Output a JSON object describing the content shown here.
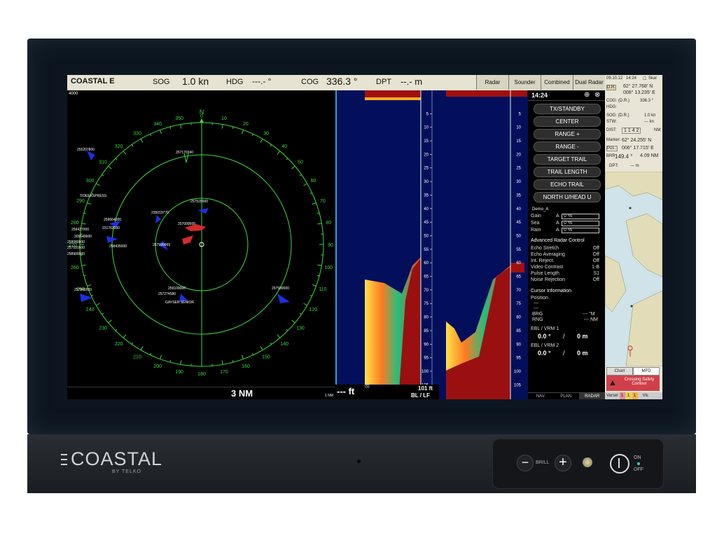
{
  "brand": {
    "name": "COASTAL",
    "sub": "BY TELKO"
  },
  "controls": {
    "brill": "BRILL",
    "on": "ON",
    "off": "OFF"
  },
  "topbar": {
    "product": "COASTAL E",
    "sog_label": "SOG",
    "sog_value": "1.0 kn",
    "hdg_label": "HDG",
    "hdg_value": "---.- °",
    "cog_label": "COG",
    "cog_value": "336.3 °",
    "dpt_label": "DPT",
    "dpt_value": "--.- m",
    "tabs": [
      "Radar",
      "Sounder",
      "Combined",
      "Dual Radar"
    ]
  },
  "radar": {
    "range": "3 NM",
    "corner_range": "4000",
    "small_range": "1 NM",
    "ring_labels": [
      "0",
      "10",
      "20",
      "30",
      "40",
      "50",
      "60",
      "70",
      "80",
      "90",
      "100",
      "110",
      "120",
      "130",
      "140",
      "150",
      "160",
      "170",
      "180",
      "190",
      "200",
      "210",
      "220",
      "230",
      "240",
      "250",
      "260",
      "270",
      "280",
      "290",
      "300",
      "310",
      "320",
      "330",
      "340",
      "350"
    ],
    "targets": [
      "257170340",
      "255207800",
      "TIDEEKSPRESS",
      "257529000",
      "235019770",
      "257009500",
      "259664000",
      "231763000",
      "259437000",
      "305649000",
      "258080000",
      "257591600",
      "258900000",
      "257999969",
      "258435000",
      "257846000",
      "259109000",
      "257274580",
      "GAYSER SENIOR",
      "257599000"
    ]
  },
  "sounder": {
    "depth_ticks": [
      "5",
      "10",
      "15",
      "20",
      "25",
      "30",
      "35",
      "40",
      "45",
      "50",
      "55",
      "60",
      "65",
      "70",
      "75",
      "80",
      "85",
      "90",
      "95",
      "100",
      "105"
    ],
    "depth_readout": "--- ft",
    "depth_sup": "(S)",
    "range_label": "101 ft",
    "mode": "BL / LF"
  },
  "menu": {
    "time": "14:24",
    "buttons": [
      "TX/STANDBY",
      "CENTER",
      "RANGE +",
      "RANGE -",
      "TARGET TRAIL",
      "TRAIL LENGTH",
      "ECHO TRAIL",
      "NORTH U/HEAD U"
    ],
    "demo": "Demo_A",
    "gain_rows": [
      {
        "label": "Gain",
        "mode": "A",
        "value": "0 %"
      },
      {
        "label": "Sea",
        "mode": "A",
        "value": "0 %"
      },
      {
        "label": "Rain",
        "mode": "A",
        "value": "0 %"
      }
    ],
    "adv_title": "Advanced Radar Control",
    "adv_rows": [
      {
        "label": "Echo Stretch",
        "value": "Off"
      },
      {
        "label": "Echo Averaging",
        "value": "Off"
      },
      {
        "label": "Int. Reject.",
        "value": "Off"
      },
      {
        "label": "Video Contrast",
        "value": "1-B"
      },
      {
        "label": "Pulse Length",
        "value": "S1"
      },
      {
        "label": "Noise Rejection",
        "value": "Off"
      }
    ],
    "cursor_title": "Cursor Information",
    "position_label": "Position",
    "position_value1": "---",
    "position_value2": "---",
    "brg_label": "BRG",
    "brg_value": "--- °M",
    "rng_label": "RNG",
    "rng_value": "--- NM",
    "ebl1_title": "EBL / VRM 1",
    "ebl1_deg": "0.0 °",
    "ebl1_slash": "/",
    "ebl1_m": "0 m",
    "ebl2_title": "EBL / VRM 2",
    "ebl2_deg": "0.0 °",
    "ebl2_slash": "/",
    "ebl2_m": "0 m",
    "bottom_tabs": [
      "NAV.",
      "PLAN.",
      "RADAR"
    ]
  },
  "rightpanel": {
    "date": "09.10.12",
    "time": "14:24",
    "skal": "Skal",
    "dr": "D.R.",
    "lat": "62° 27.768' N",
    "lon": "006° 13.235' E",
    "cog_label": "COG: (D.R.)",
    "cog_value": "336.3 °",
    "hdg_label": "HDG:",
    "sog_label": "SOG: (D.R.)",
    "sog_value": "1.0 kn",
    "stw_label": "STW:",
    "stw_value": "--- kn",
    "dist_label": "DIST:",
    "dist_value": "1 1 4 2",
    "dist_unit": "NM",
    "marker_label": "Marker:",
    "marker_lat": "62° 24.255' N",
    "pos_label": "Pos.:",
    "marker_lon": "006° 17.715' E",
    "brr_label": "BRR",
    "brr_value": "149.4 °",
    "brr_dist": "4.09 NM",
    "dpt_label": "DPT:",
    "dpt_value": "--- m",
    "chart_tab": "Chart",
    "mfd_tab": "MFD",
    "alert": "Crossing Safety Contour",
    "status": [
      "Varsel",
      "1",
      "1",
      "1",
      "Vis"
    ]
  },
  "colors": {
    "radar_green": "#3fd93f",
    "menu_bg": "#000000",
    "sounder_bg": "#040f5c",
    "alert_red": "#d0404a"
  }
}
